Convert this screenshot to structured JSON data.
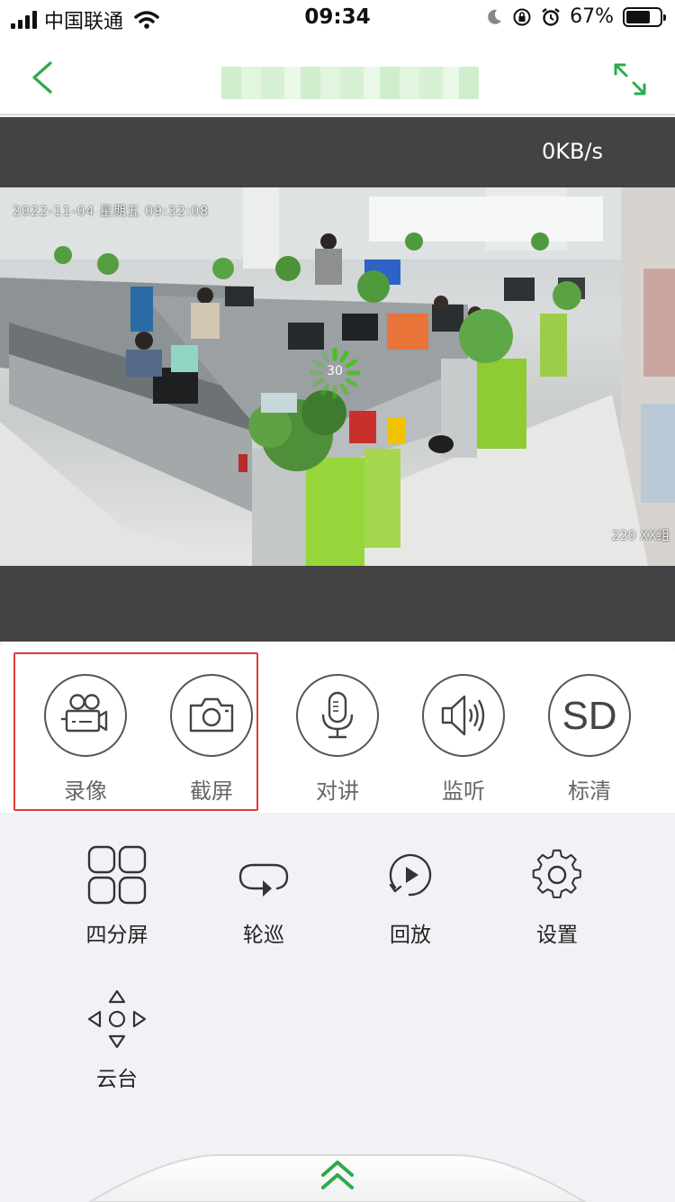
{
  "status_bar": {
    "carrier": "中国联通",
    "time": "09:34",
    "battery_percent": "67%"
  },
  "nav": {
    "title": "",
    "accent_color": "#2eaa4a",
    "back_icon": "chevron-left-icon",
    "expand_icon": "fullscreen-expand-icon"
  },
  "video": {
    "speed": "0KB/s",
    "osd_timestamp": "2022-11-04 星期五 09:32:08",
    "osd_camera": "220 XX组",
    "loading_count": "30"
  },
  "tools": [
    {
      "id": "record",
      "label": "录像",
      "icon": "video-camera-icon"
    },
    {
      "id": "screenshot",
      "label": "截屏",
      "icon": "camera-icon"
    },
    {
      "id": "talk",
      "label": "对讲",
      "icon": "microphone-icon"
    },
    {
      "id": "listen",
      "label": "监听",
      "icon": "speaker-icon"
    },
    {
      "id": "quality",
      "label": "标清",
      "icon": "sd-icon"
    }
  ],
  "grid": [
    {
      "id": "quad",
      "label": "四分屏",
      "icon": "four-split-icon"
    },
    {
      "id": "patrol",
      "label": "轮巡",
      "icon": "patrol-loop-icon"
    },
    {
      "id": "playback",
      "label": "回放",
      "icon": "playback-icon"
    },
    {
      "id": "settings",
      "label": "设置",
      "icon": "gear-icon"
    },
    {
      "id": "ptz",
      "label": "云台",
      "icon": "ptz-direction-icon"
    }
  ],
  "highlight_color": "#e03b36"
}
